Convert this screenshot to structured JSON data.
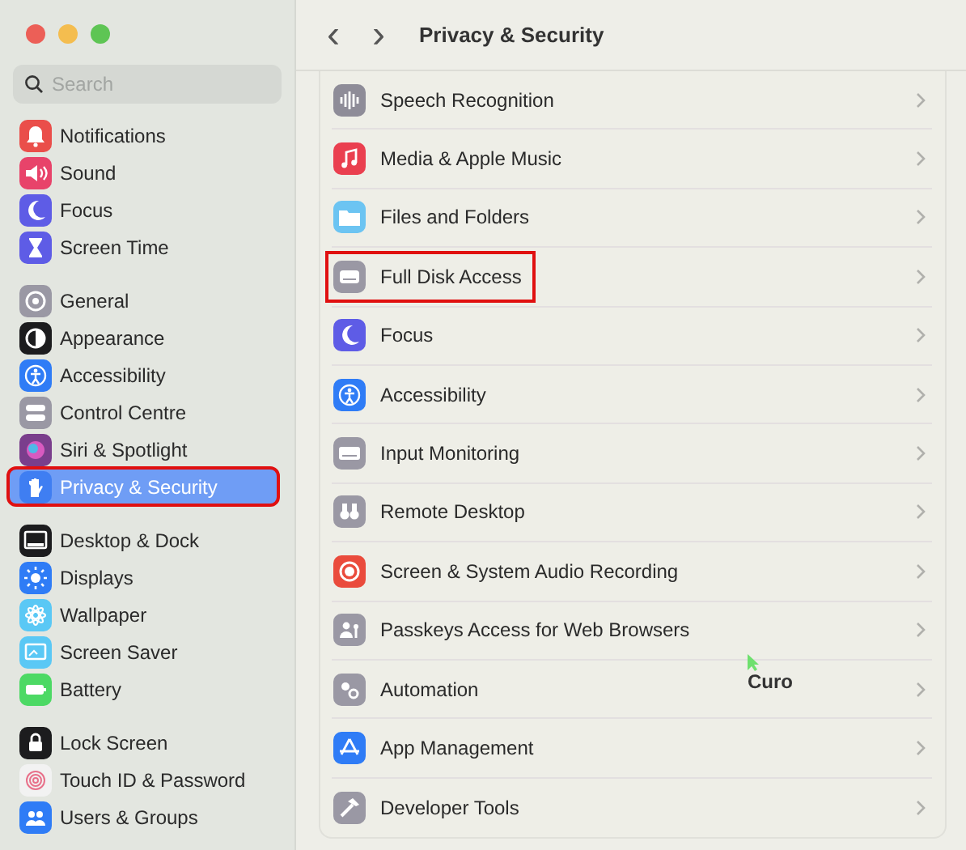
{
  "sidebar": {
    "search": {
      "placeholder": "Search"
    },
    "groups": [
      {
        "items": [
          {
            "label": "Notifications",
            "color": "#ea4e4a",
            "selected": false,
            "outlined": false
          },
          {
            "label": "Sound",
            "color": "#e8436a",
            "selected": false,
            "outlined": false
          },
          {
            "label": "Focus",
            "color": "#5e5ce6",
            "selected": false,
            "outlined": false
          },
          {
            "label": "Screen Time",
            "color": "#5e5ce6",
            "selected": false,
            "outlined": false
          }
        ]
      },
      {
        "items": [
          {
            "label": "General",
            "color": "#9a98a4",
            "selected": false,
            "outlined": false
          },
          {
            "label": "Appearance",
            "color": "#1c1c1e",
            "selected": false,
            "outlined": false
          },
          {
            "label": "Accessibility",
            "color": "#2f7cf6",
            "selected": false,
            "outlined": false
          },
          {
            "label": "Control Centre",
            "color": "#9a98a4",
            "selected": false,
            "outlined": false
          },
          {
            "label": "Siri & Spotlight",
            "color": "#7a3e8c",
            "selected": false,
            "outlined": false
          },
          {
            "label": "Privacy & Security",
            "color": "#3f7ef2",
            "selected": true,
            "outlined": true
          }
        ]
      },
      {
        "items": [
          {
            "label": "Desktop & Dock",
            "color": "#1c1c1e",
            "selected": false,
            "outlined": false
          },
          {
            "label": "Displays",
            "color": "#2f7cf6",
            "selected": false,
            "outlined": false
          },
          {
            "label": "Wallpaper",
            "color": "#5ac8f5",
            "selected": false,
            "outlined": false
          },
          {
            "label": "Screen Saver",
            "color": "#5ac8f5",
            "selected": false,
            "outlined": false
          },
          {
            "label": "Battery",
            "color": "#4cd964",
            "selected": false,
            "outlined": false
          }
        ]
      },
      {
        "items": [
          {
            "label": "Lock Screen",
            "color": "#1c1c1e",
            "selected": false,
            "outlined": false
          },
          {
            "label": "Touch ID & Password",
            "color": "#f2f2f2",
            "selected": false,
            "outlined": false
          },
          {
            "label": "Users & Groups",
            "color": "#2f7cf6",
            "selected": false,
            "outlined": false
          }
        ]
      }
    ]
  },
  "toolbar": {
    "back": "‹",
    "forward": "›",
    "title": "Privacy & Security"
  },
  "list": [
    {
      "label": "Speech Recognition",
      "color": "#8e8c98",
      "outlined": false
    },
    {
      "label": "Media & Apple Music",
      "color": "#ea3f4f",
      "outlined": false
    },
    {
      "label": "Files and Folders",
      "color": "#6cc4f2",
      "outlined": false
    },
    {
      "label": "Full Disk Access",
      "color": "#9a98a4",
      "outlined": true
    },
    {
      "label": "Focus",
      "color": "#5e5ce6",
      "outlined": false
    },
    {
      "label": "Accessibility",
      "color": "#2f7cf6",
      "outlined": false
    },
    {
      "label": "Input Monitoring",
      "color": "#9a98a4",
      "outlined": false
    },
    {
      "label": "Remote Desktop",
      "color": "#9a98a4",
      "outlined": false
    },
    {
      "label": "Screen & System Audio Recording",
      "color": "#ea4b3c",
      "outlined": false
    },
    {
      "label": "Passkeys Access for Web Browsers",
      "color": "#9a98a4",
      "outlined": false
    },
    {
      "label": "Automation",
      "color": "#9a98a4",
      "outlined": false
    },
    {
      "label": "App Management",
      "color": "#2f7cf6",
      "outlined": false
    },
    {
      "label": "Developer Tools",
      "color": "#9a98a4",
      "outlined": false
    }
  ],
  "cursor": {
    "label": "Curo"
  }
}
